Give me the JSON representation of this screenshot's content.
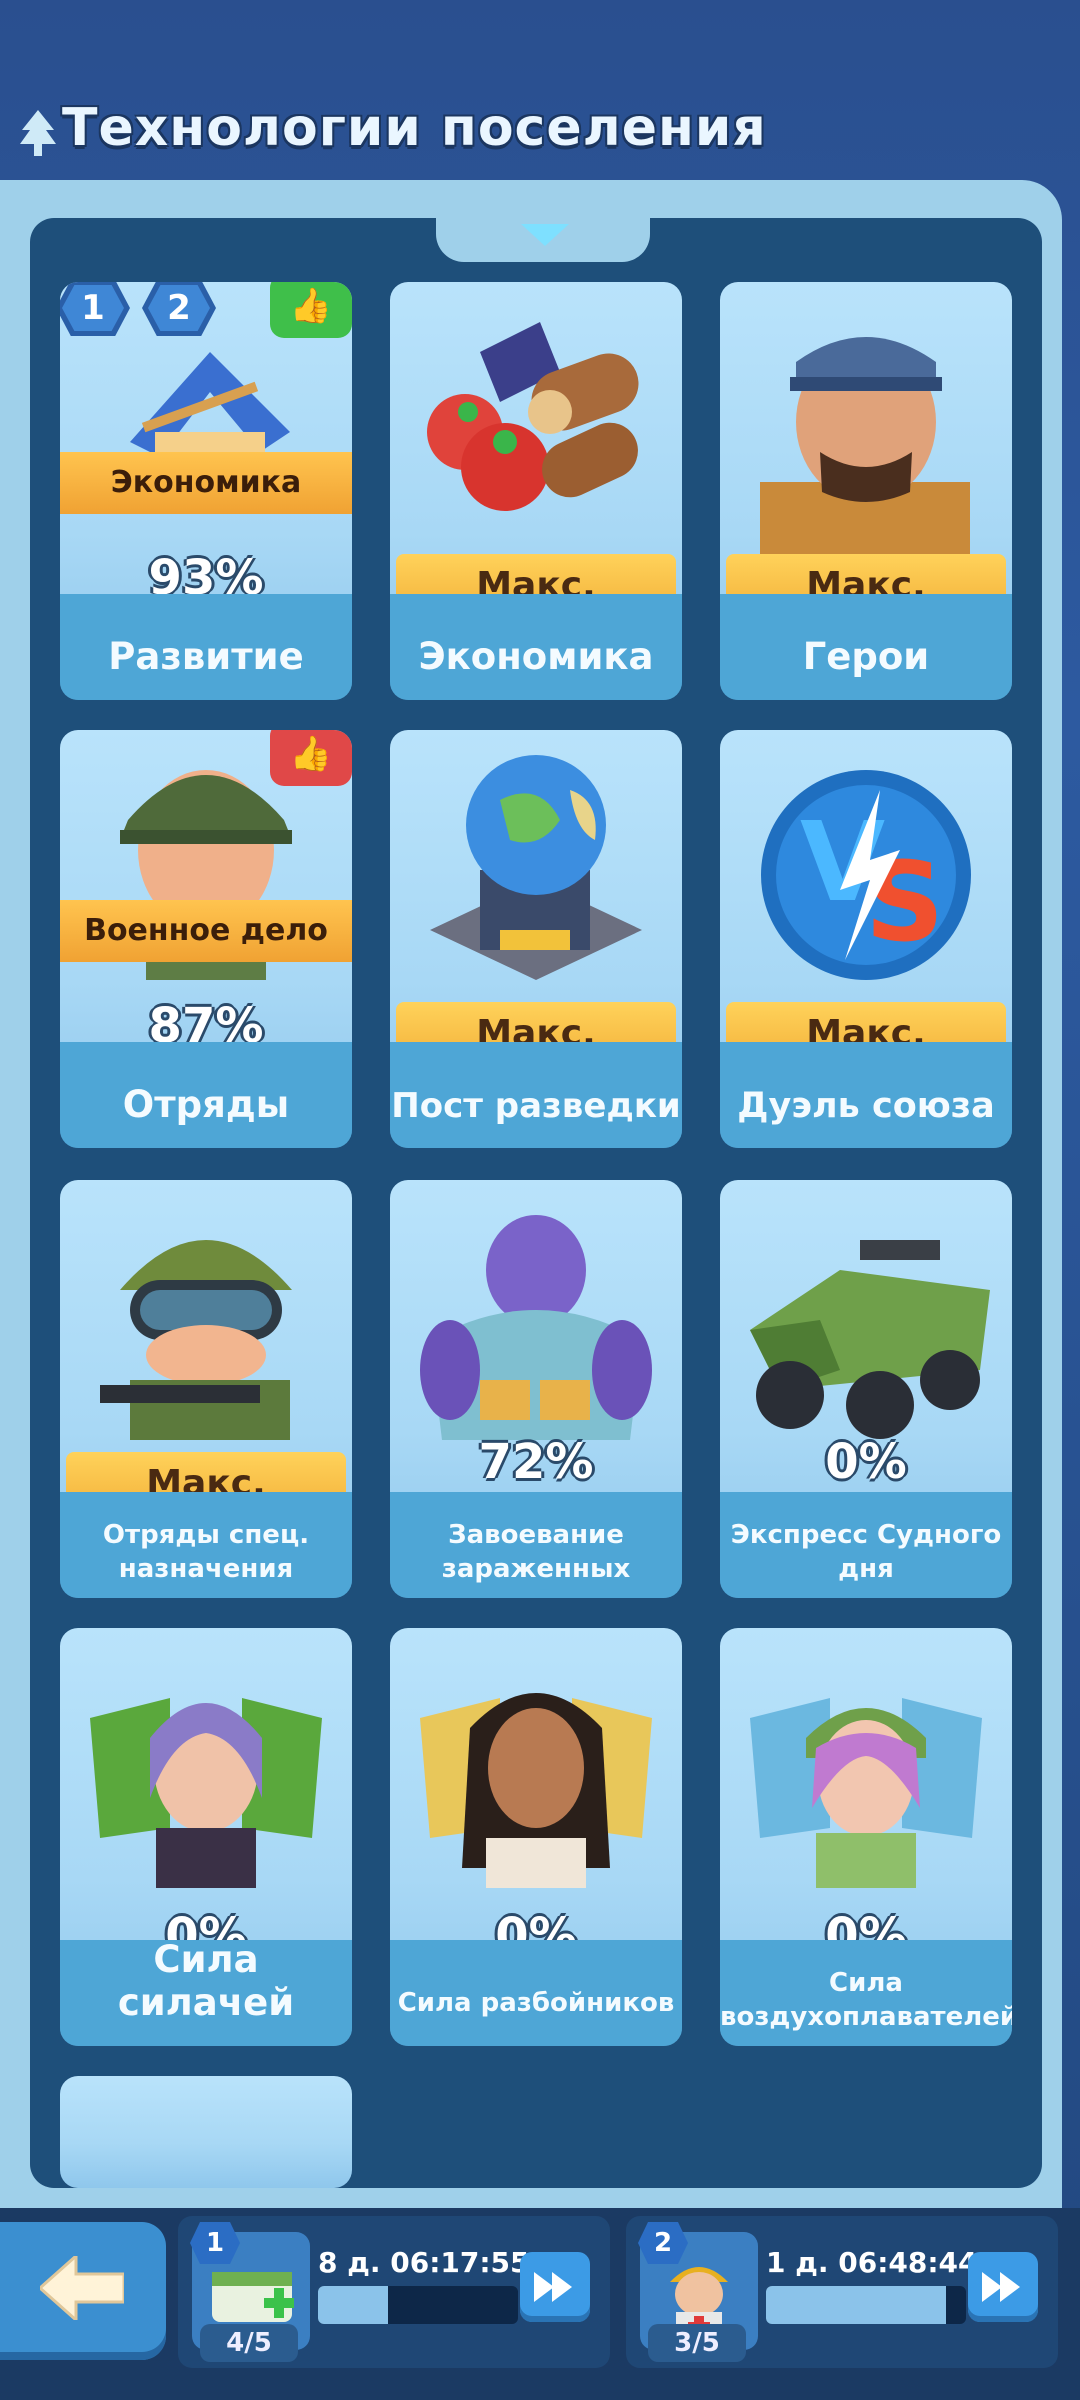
{
  "header": {
    "title": "Технологии поселения"
  },
  "cards": [
    {
      "name": "Развитие",
      "percent": "93%",
      "ribbon": "Экономика",
      "badges": [
        "1",
        "2"
      ],
      "thumb": "up"
    },
    {
      "name": "Экономика",
      "max_label": "Макс."
    },
    {
      "name": "Герои",
      "max_label": "Макс."
    },
    {
      "name": "Отряды",
      "percent": "87%",
      "ribbon": "Военное дело",
      "thumb": "up-red"
    },
    {
      "name": "Пост разведки",
      "max_label": "Макс."
    },
    {
      "name": "Дуэль союза",
      "max_label": "Макс."
    },
    {
      "name": "Отряды спец. назначения",
      "max_label": "Макс."
    },
    {
      "name": "Завоевание зараженных",
      "percent": "72%"
    },
    {
      "name": "Экспресс Судного дня",
      "percent": "0%"
    },
    {
      "name": "Сила силачей",
      "percent": "0%"
    },
    {
      "name": "Сила разбойников",
      "percent": "0%"
    },
    {
      "name": "Сила воздухоплавателей",
      "percent": "0%"
    }
  ],
  "queues": [
    {
      "number": "1",
      "timer": "8 д. 06:17:55",
      "count": "4/5",
      "progress": 0.35,
      "icon": "medkit-icon"
    },
    {
      "number": "2",
      "timer": "1 д. 06:48:44",
      "count": "3/5",
      "progress": 0.9,
      "icon": "medic-icon"
    }
  ]
}
